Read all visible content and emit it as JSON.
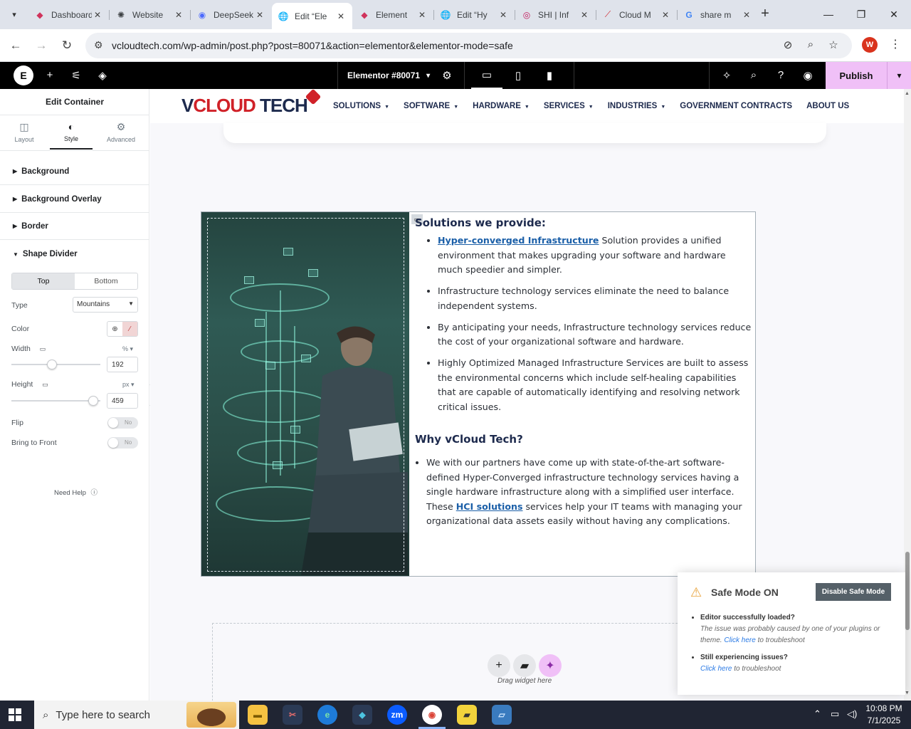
{
  "browser": {
    "tabs": [
      {
        "label": "Dashboard",
        "icon": "elementor-icon"
      },
      {
        "label": "Website",
        "icon": "openai-icon"
      },
      {
        "label": "DeepSeek",
        "icon": "deepseek-icon"
      },
      {
        "label": "Edit “Ele",
        "icon": "globe-icon"
      },
      {
        "label": "Element",
        "icon": "elementor-icon"
      },
      {
        "label": "Edit “Hy",
        "icon": "globe-icon"
      },
      {
        "label": "SHI | Inf",
        "icon": "shi-icon"
      },
      {
        "label": "Cloud M",
        "icon": "cloud-icon"
      },
      {
        "label": "share m",
        "icon": "google-icon"
      }
    ],
    "active_tab_index": 3,
    "url": "vcloudtech.com/wp-admin/post.php?post=80071&action=elementor&elementor-mode=safe",
    "profile_initial": "W"
  },
  "elementor_bar": {
    "document_title": "Elementor #80071",
    "publish_label": "Publish"
  },
  "panel": {
    "title": "Edit Container",
    "tabs": [
      {
        "label": "Layout"
      },
      {
        "label": "Style"
      },
      {
        "label": "Advanced"
      }
    ],
    "active_tab": "Style",
    "sections": {
      "background": "Background",
      "background_overlay": "Background Overlay",
      "border": "Border",
      "shape_divider": "Shape Divider"
    },
    "shape_divider": {
      "position_options": [
        "Top",
        "Bottom"
      ],
      "position_selected": "Top",
      "type_label": "Type",
      "type_value": "Mountains",
      "color_label": "Color",
      "width_label": "Width",
      "width_unit": "%",
      "width_value": "192",
      "height_label": "Height",
      "height_unit": "px",
      "height_value": "459",
      "flip_label": "Flip",
      "flip_value": "No",
      "bring_front_label": "Bring to Front",
      "bring_front_value": "No"
    },
    "need_help": "Need Help"
  },
  "site": {
    "logo_v": "V",
    "logo_cloud": "CLOUD",
    "logo_tech": " TECH",
    "nav": [
      "SOLUTIONS",
      "SOFTWARE",
      "HARDWARE",
      "SERVICES",
      "INDUSTRIES",
      "GOVERNMENT CONTRACTS",
      "ABOUT US"
    ],
    "heading": "Solutions we provide:",
    "bullets": [
      {
        "link": "Hyper-converged Infrastructure",
        "text": " Solution provides a unified environment that makes upgrading your software and hardware much speedier and simpler."
      },
      {
        "link": "",
        "text": "Infrastructure technology services eliminate the need to balance independent systems."
      },
      {
        "link": "",
        "text": "By anticipating your needs, Infrastructure technology services reduce the cost of your organizational software and hardware."
      },
      {
        "link": "",
        "text": "Highly Optimized Managed Infrastructure Services are built to assess the environmental concerns which include self-healing capabilities that are capable of automatically identifying and resolving network critical issues."
      }
    ],
    "why_heading": "Why vCloud Tech?",
    "why_text_1": "We with our partners have come up with state-of-the-art software-defined Hyper-Converged infrastructure technology services having a single hardware infrastructure along with a simplified user interface. These ",
    "why_link": "HCI solutions",
    "why_text_2": " services help your IT teams with managing your organizational data assets easily without having any complications.",
    "drag_widget": "Drag widget here"
  },
  "safe_mode": {
    "title": "Safe Mode ON",
    "button": "Disable Safe Mode",
    "item1_title": "Editor successfully loaded?",
    "item1_text": "The issue was probably caused by one of your plugins or theme.",
    "item1_link": "Click here",
    "item1_suffix": " to troubleshoot",
    "item2_title": "Still experiencing issues?",
    "item2_link": "Click here",
    "item2_suffix": " to troubleshoot"
  },
  "taskbar": {
    "search_placeholder": "Type here to search",
    "time": "10:08 PM",
    "date": "7/1/2025"
  },
  "colors": {
    "publish_bg": "#f0c0f7",
    "brand_navy": "#1d2a4d",
    "brand_red": "#d02128",
    "link_blue": "#1b5fa8",
    "safe_button": "#556068"
  }
}
